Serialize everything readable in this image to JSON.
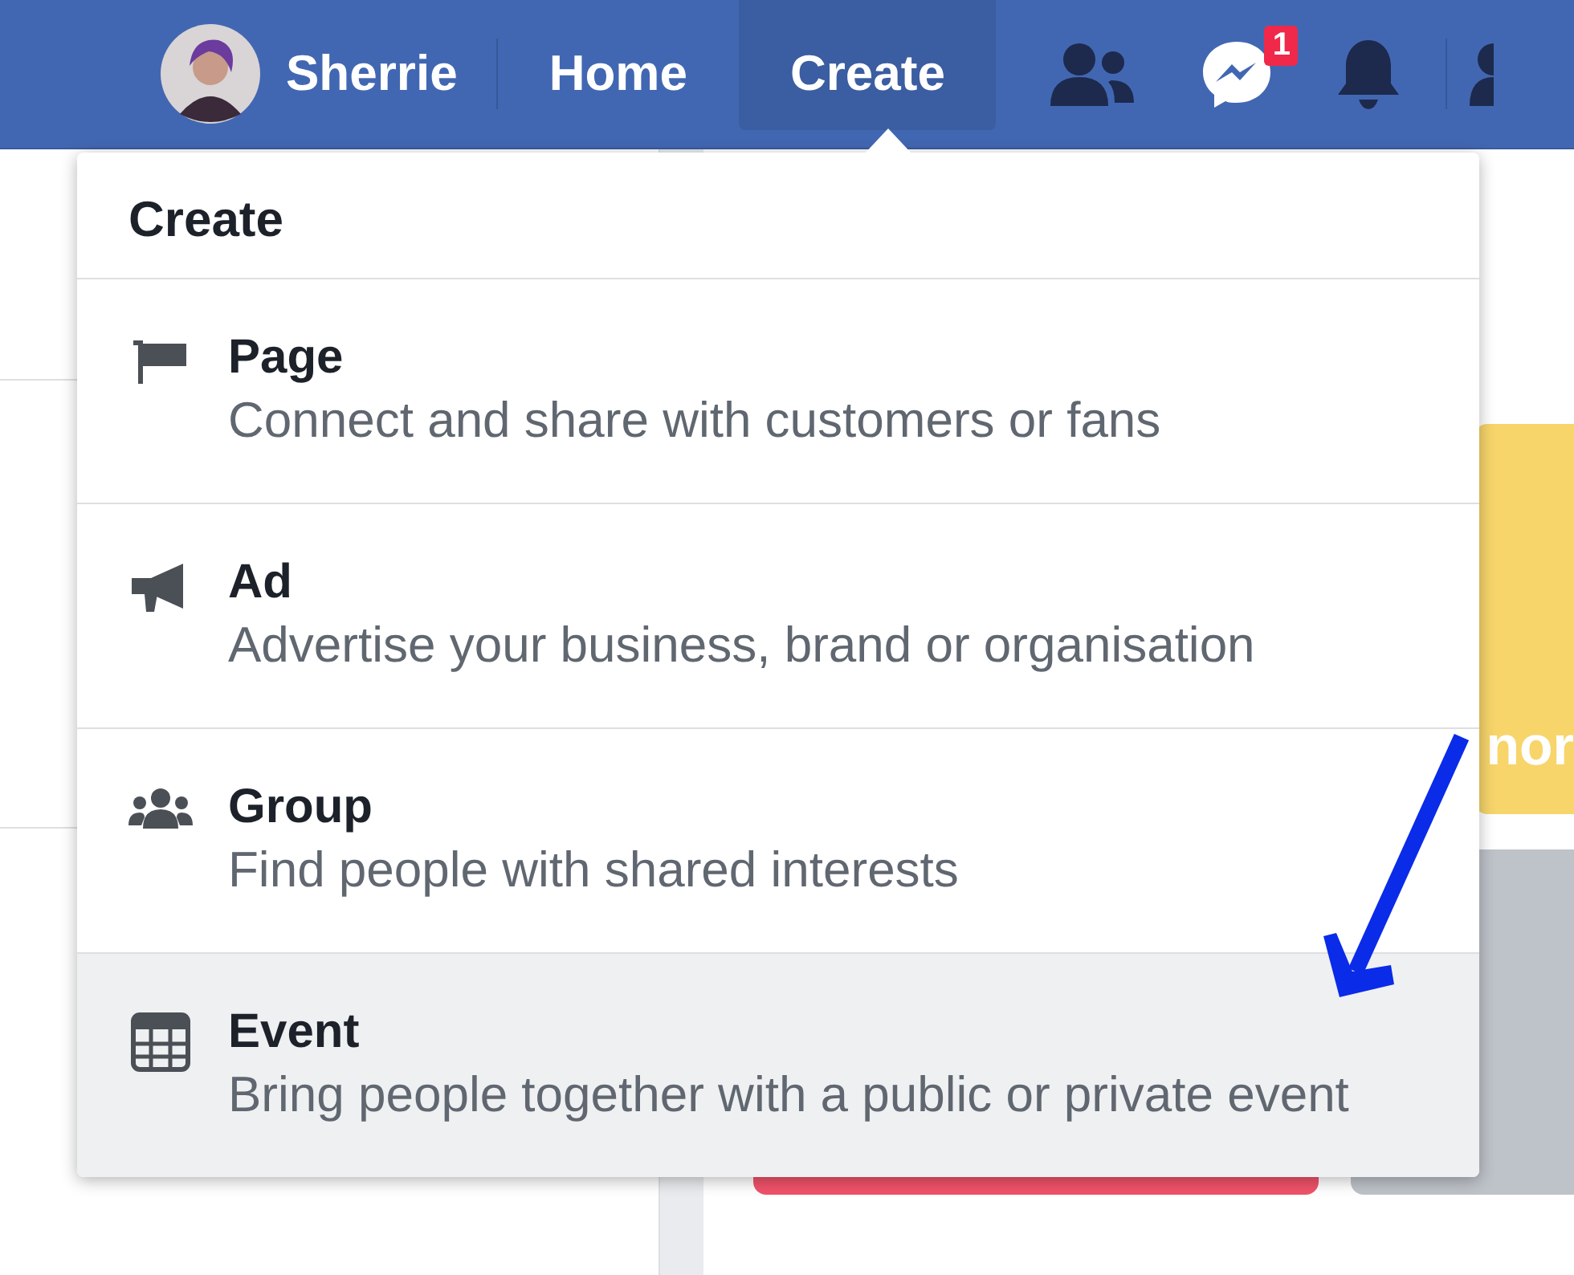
{
  "nav": {
    "user": {
      "name": "Sherrie"
    },
    "items": [
      {
        "label": "Home",
        "selected": false
      },
      {
        "label": "Create",
        "selected": true
      }
    ],
    "messenger_badge": "1"
  },
  "menu": {
    "title": "Create",
    "items": [
      {
        "kind": "page",
        "title": "Page",
        "description": "Connect and share with customers or fans",
        "selected": false
      },
      {
        "kind": "ad",
        "title": "Ad",
        "description": "Advertise your business, brand or organisation",
        "selected": false
      },
      {
        "kind": "group",
        "title": "Group",
        "description": "Find people with shared interests",
        "selected": false
      },
      {
        "kind": "event",
        "title": "Event",
        "description": "Bring people together with a public or private event",
        "selected": true
      }
    ]
  },
  "promo_card": {
    "text": "nor"
  }
}
